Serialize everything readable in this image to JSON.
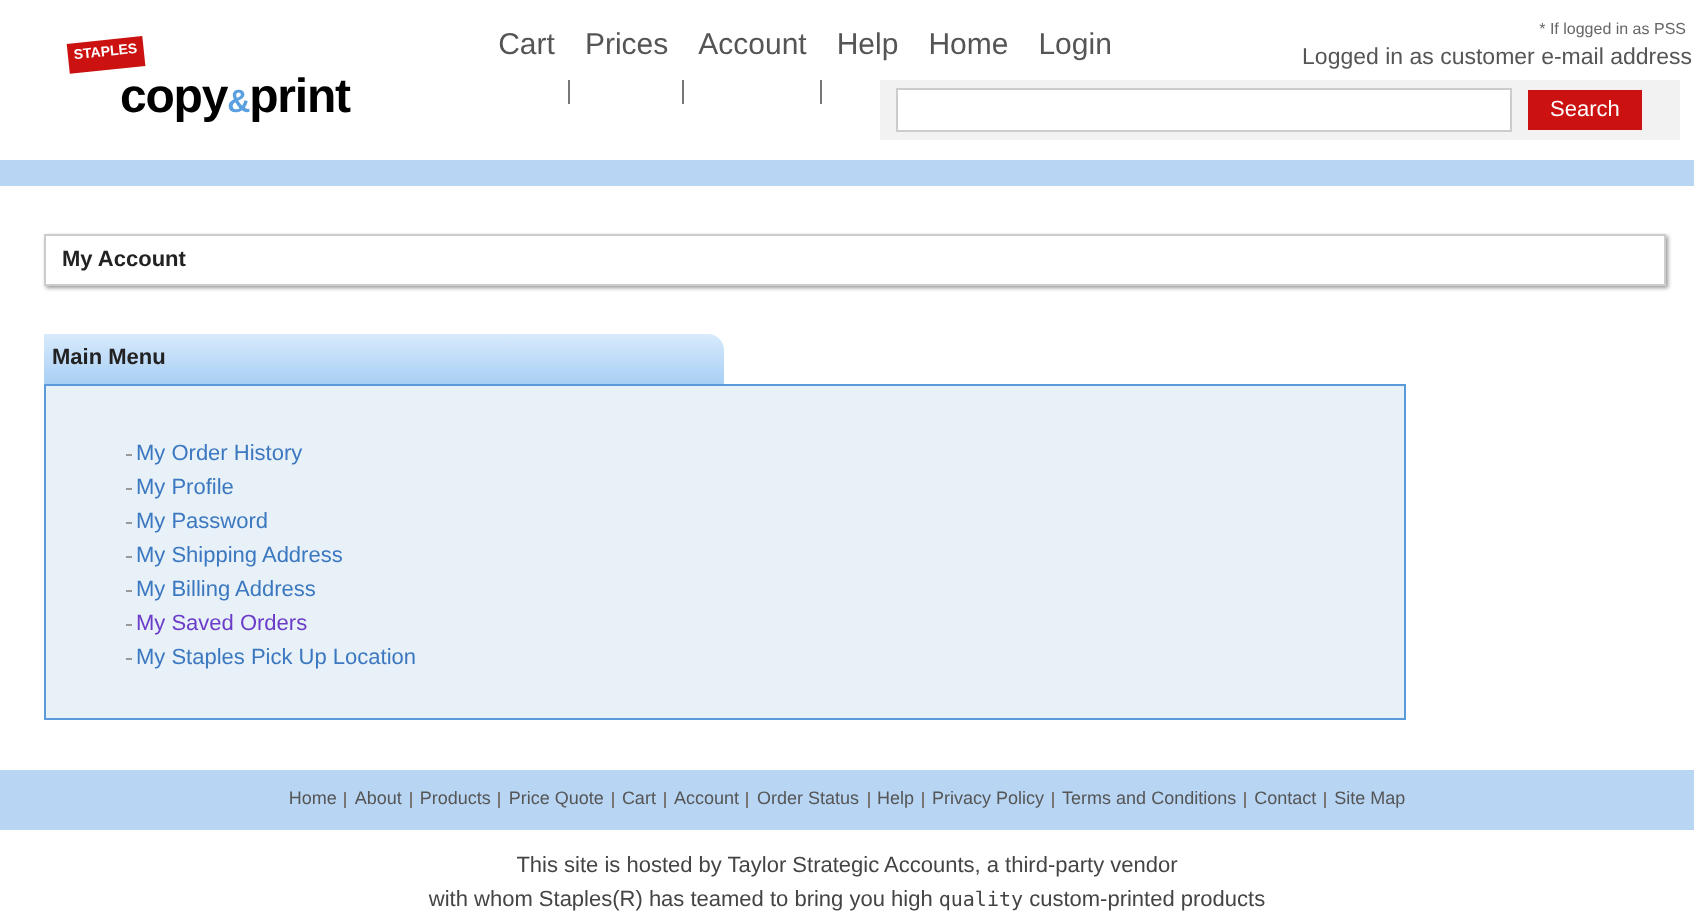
{
  "logo": {
    "tag": "STAPLES",
    "word_1": "copy",
    "ampersand": "&",
    "word_2": "print"
  },
  "top_nav": [
    "Cart",
    "Prices",
    "Account",
    "Help",
    "Home",
    "Login"
  ],
  "login_note": "* If logged in as PSS",
  "login_status": "Logged in as customer e-mail address",
  "search": {
    "button": "Search"
  },
  "page_title": "My Account",
  "main_menu": {
    "title": "Main Menu",
    "items": [
      {
        "label": "My Order History",
        "visited": false
      },
      {
        "label": "My Profile",
        "visited": false
      },
      {
        "label": "My Password",
        "visited": false
      },
      {
        "label": "My Shipping Address",
        "visited": false
      },
      {
        "label": "My Billing Address",
        "visited": false
      },
      {
        "label": "My Saved Orders",
        "visited": true
      },
      {
        "label": "My Staples Pick Up Location",
        "visited": false
      }
    ]
  },
  "footer_nav": [
    "Home",
    "About",
    "Products",
    "Price Quote",
    "Cart",
    "Account",
    "Order Status",
    "Help",
    "Privacy Policy",
    "Terms and Conditions",
    "Contact",
    "Site Map"
  ],
  "disclaimer": {
    "line_1": "This site is hosted by Taylor Strategic Accounts, a third-party vendor",
    "line_2_before": "with whom Staples(R) has teamed to bring you high ",
    "line_2_special": "quality",
    "line_2_after": " custom-printed products"
  }
}
